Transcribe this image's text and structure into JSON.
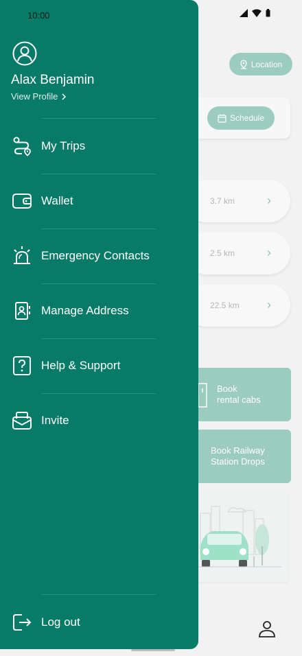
{
  "status_bar": {
    "time": "10:00"
  },
  "background": {
    "location_button": "Location",
    "schedule_button": "Schedule",
    "destinations": [
      {
        "distance": "3.7 km"
      },
      {
        "distance": "2.5 km"
      },
      {
        "distance": "22.5 km"
      }
    ],
    "services": [
      {
        "label_line1": "Book",
        "label_line2": "rental cabs"
      },
      {
        "label_line1": "Book Railway",
        "label_line2": "Station Drops"
      }
    ],
    "accent_color": "#9ccbbf"
  },
  "drawer": {
    "background_color": "#077b68",
    "user_name": "Alax Benjamin",
    "view_profile": "View Profile",
    "menu": [
      {
        "label": "My Trips",
        "icon": "route-icon"
      },
      {
        "label": "Wallet",
        "icon": "wallet-icon"
      },
      {
        "label": "Emergency Contacts",
        "icon": "siren-icon"
      },
      {
        "label": "Manage Address",
        "icon": "contact-book-icon"
      },
      {
        "label": "Help & Support",
        "icon": "help-icon"
      },
      {
        "label": "Invite",
        "icon": "invite-icon"
      }
    ],
    "logout": {
      "label": "Log out",
      "icon": "logout-icon"
    }
  }
}
